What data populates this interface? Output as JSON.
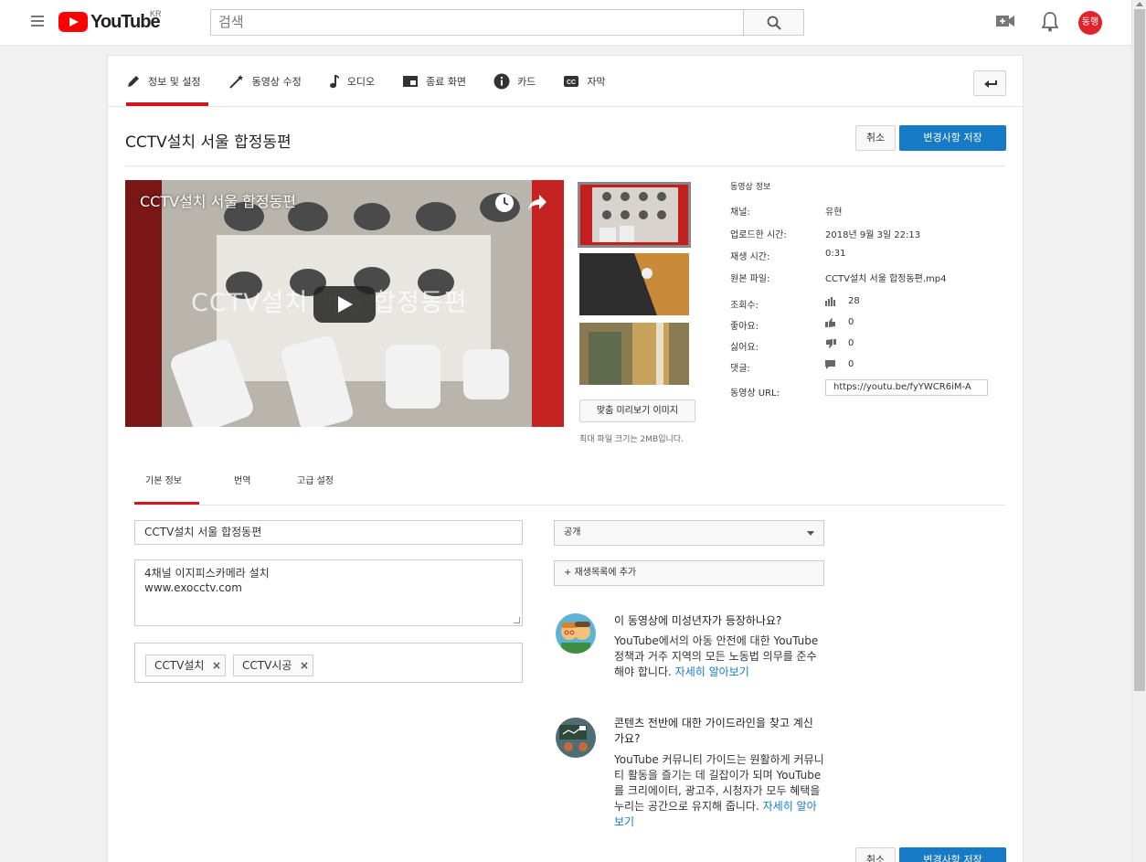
{
  "masthead": {
    "logo_text": "YouTube",
    "region": "KR",
    "search_placeholder": "검색",
    "avatar_text": "동행"
  },
  "tabs": [
    {
      "label": "정보 및 설정",
      "icon": "pencil-icon"
    },
    {
      "label": "동영상 수정",
      "icon": "magic-wand-icon"
    },
    {
      "label": "오디오",
      "icon": "music-note-icon"
    },
    {
      "label": "종료 화면",
      "icon": "end-screen-icon"
    },
    {
      "label": "카드",
      "icon": "info-icon"
    },
    {
      "label": "자막",
      "icon": "cc-icon"
    }
  ],
  "editor": {
    "video_title": "CCTV설치 서울 합정동편",
    "cancel_label": "취소",
    "save_label": "변경사항 저장"
  },
  "player": {
    "title": "CCTV설치 서울 합정동편",
    "overlay_text": "CCTV설치 서울 합정동편"
  },
  "thumbnails": {
    "custom_button": "맞춤 미리보기 이미지",
    "max_size_note": "최대 파일 크기는 2MB입니다."
  },
  "video_info": {
    "heading": "동영상 정보",
    "channel_label": "채널:",
    "channel_value": "유현",
    "upload_label": "업로드한 시간:",
    "upload_value": "2018년 9월 3일 22:13",
    "duration_label": "재생 시간:",
    "duration_value": "0:31",
    "file_label": "원본 파일:",
    "file_value": "CCTV설치 서울 합정동편.mp4",
    "views_label": "조회수:",
    "views_value": "28",
    "likes_label": "좋아요:",
    "likes_value": "0",
    "dislikes_label": "싫어요:",
    "dislikes_value": "0",
    "comments_label": "댓글:",
    "comments_value": "0",
    "url_label": "동영상 URL:",
    "url_value": "https://youtu.be/fyYWCR6iM-A"
  },
  "subtabs": [
    "기본 정보",
    "번역",
    "고급 설정"
  ],
  "form": {
    "title_value": "CCTV설치 서울 합정동편",
    "description_line1": "4채널 이지피스카메라 설치",
    "description_line2": "www.exocctv.com",
    "tags": [
      "CCTV설치",
      "CCTV시공"
    ],
    "tag_remove": "×",
    "privacy_value": "공개",
    "playlist_label": "+ 재생목록에 추가"
  },
  "help": {
    "kids_title": "이 동영상에 미성년자가 등장하나요?",
    "kids_body": "YouTube에서의 아동 안전에 대한 YouTube 정책과 거주 지역의 모든 노동법 의무를 준수해야 합니다.",
    "kids_link": "자세히 알아보기",
    "guide_title": "콘텐츠 전반에 대한 가이드라인을 찾고 계신가요?",
    "guide_body": "YouTube 커뮤니티 가이드는 원활하게 커뮤니티 활동을 즐기는 데 길잡이가 되며 YouTube를 크리에이터, 광고주, 시청자가 모두 혜택을 누리는 공간으로 유지해 줍니다.",
    "guide_link": "자세히 알아보기"
  },
  "colors": {
    "accent": "#cc181e",
    "primary_button": "#167ac6",
    "link": "#167ac6"
  }
}
